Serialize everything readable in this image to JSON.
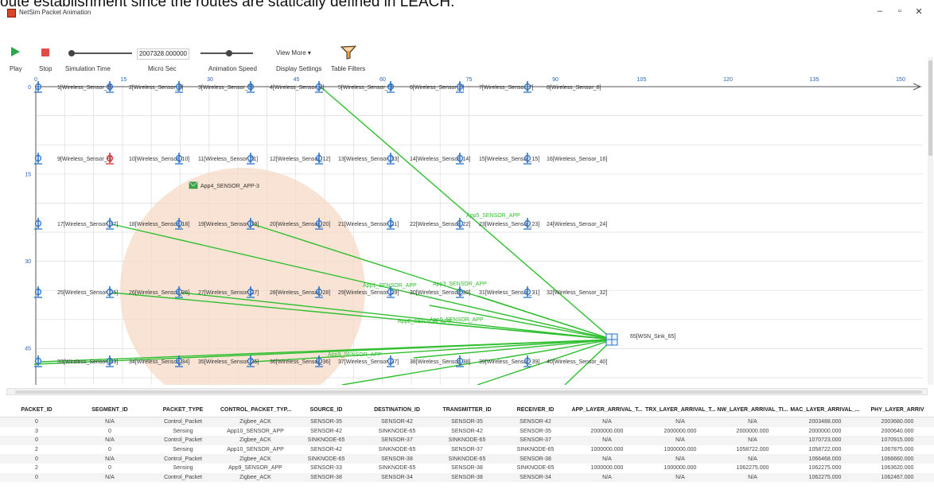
{
  "document": {
    "text": "oute establishment since the routes are statically defined in LEACH."
  },
  "window": {
    "title": "NetSim Packet Animation",
    "minimize": "–",
    "maximize": "▫",
    "close": "✕"
  },
  "toolbar": {
    "play_label": "Play",
    "stop_label": "Stop",
    "sim_time_label": "Simulation Time",
    "sim_time_value": "2007328.000000",
    "micro_sec_label": "Micro Sec",
    "anim_speed_label": "Animation Speed",
    "view_more_label": "View More ▾",
    "display_settings_label": "Display Settings",
    "table_filters_label": "Table Filters",
    "sim_time_progress": 0.02,
    "anim_speed_level": 0.55
  },
  "canvas": {
    "x_ticks": [
      "0",
      "15",
      "30",
      "45",
      "60",
      "75",
      "90",
      "105",
      "120",
      "135",
      "150"
    ],
    "y_ticks": [
      "0",
      "15",
      "30",
      "45"
    ],
    "circle_label": "App4_SENSOR_APP-3",
    "nodes": [
      {
        "id": 1,
        "label": "1[Wireless_Sensor_1]"
      },
      {
        "id": 2,
        "label": "2[Wireless_Sensor_2]"
      },
      {
        "id": 3,
        "label": "3[Wireless_Sensor_3]"
      },
      {
        "id": 4,
        "label": "4[Wireless_Sensor_4]"
      },
      {
        "id": 5,
        "label": "5[Wireless_Sensor_5]"
      },
      {
        "id": 6,
        "label": "6[Wireless_Sensor_6]"
      },
      {
        "id": 7,
        "label": "7[Wireless_Sensor_7]"
      },
      {
        "id": 8,
        "label": "8[Wireless_Sensor_8]"
      },
      {
        "id": 9,
        "label": "9[Wireless_Sensor_9]"
      },
      {
        "id": 10,
        "label": "10[Wireless_Sensor_10]"
      },
      {
        "id": 11,
        "label": "11[Wireless_Sensor_11]"
      },
      {
        "id": 12,
        "label": "12[Wireless_Sensor_12]"
      },
      {
        "id": 13,
        "label": "13[Wireless_Sensor_13]"
      },
      {
        "id": 14,
        "label": "14[Wireless_Sensor_14]"
      },
      {
        "id": 15,
        "label": "15[Wireless_Sensor_15]"
      },
      {
        "id": 16,
        "label": "16[Wireless_Sensor_16]"
      },
      {
        "id": 17,
        "label": "17[Wireless_Sensor_17]"
      },
      {
        "id": 18,
        "label": "18[Wireless_Sensor_18]"
      },
      {
        "id": 19,
        "label": "19[Wireless_Sensor_19]"
      },
      {
        "id": 20,
        "label": "20[Wireless_Sensor_20]"
      },
      {
        "id": 21,
        "label": "21[Wireless_Sensor_21]"
      },
      {
        "id": 22,
        "label": "22[Wireless_Sensor_22]"
      },
      {
        "id": 23,
        "label": "23[Wireless_Sensor_23]"
      },
      {
        "id": 24,
        "label": "24[Wireless_Sensor_24]"
      },
      {
        "id": 25,
        "label": "25[Wireless_Sensor_25]"
      },
      {
        "id": 26,
        "label": "26[Wireless_Sensor_26]"
      },
      {
        "id": 27,
        "label": "27[Wireless_Sensor_27]"
      },
      {
        "id": 28,
        "label": "28[Wireless_Sensor_28]"
      },
      {
        "id": 29,
        "label": "29[Wireless_Sensor_29]"
      },
      {
        "id": 30,
        "label": "30[Wireless_Sensor_30]"
      },
      {
        "id": 31,
        "label": "31[Wireless_Sensor_31]"
      },
      {
        "id": 32,
        "label": "32[Wireless_Sensor_32]"
      },
      {
        "id": 33,
        "label": "33[Wireless_Sensor_33]"
      },
      {
        "id": 34,
        "label": "34[Wireless_Sensor_34]"
      },
      {
        "id": 35,
        "label": "35[Wireless_Sensor_35]"
      },
      {
        "id": 36,
        "label": "36[Wireless_Sensor_36]"
      },
      {
        "id": 37,
        "label": "37[Wireless_Sensor_37]"
      },
      {
        "id": 38,
        "label": "38[Wireless_Sensor_38]"
      },
      {
        "id": 39,
        "label": "39[Wireless_Sensor_39]"
      },
      {
        "id": 40,
        "label": "40[Wireless_Sensor_40]"
      }
    ],
    "sink_label": "65[WSN_Sink_65]",
    "flow_labels": [
      "App5_SENSOR_APP",
      "App1_SENSOR_APP",
      "App3_SENSOR_APP",
      "App2_SENSOR_APP",
      "App6_SENSOR_APP",
      "App9_SENSOR_APP"
    ]
  },
  "table": {
    "columns": [
      "PACKET_ID",
      "SEGMENT_ID",
      "PACKET_TYPE",
      "CONTROL_PACKET_TYP...",
      "SOURCE_ID",
      "DESTINATION_ID",
      "TRANSMITTER_ID",
      "RECEIVER_ID",
      "APP_LAYER_ARRIVAL_T...",
      "TRX_LAYER_ARRIVAL_T...",
      "NW_LAYER_ARRIVAL_TI...",
      "MAC_LAYER_ARRIVAL_...",
      "PHY_LAYER_ARRIV"
    ],
    "rows": [
      [
        "0",
        "N/A",
        "Control_Packet",
        "Zigbee_ACK",
        "SENSOR-35",
        "SENSOR-42",
        "SENSOR-35",
        "SENSOR-42",
        "N/A",
        "N/A",
        "N/A",
        "2003488.000",
        "2003680.000"
      ],
      [
        "3",
        "0",
        "Sensing",
        "App10_SENSOR_APP",
        "SENSOR-42",
        "SINKNODE-65",
        "SENSOR-42",
        "SENSOR-35",
        "2000000.000",
        "2000000.000",
        "2000000.000",
        "2000000.000",
        "2000640.000"
      ],
      [
        "0",
        "N/A",
        "Control_Packet",
        "Zigbee_ACK",
        "SINKNODE-65",
        "SENSOR-37",
        "SINKNODE-65",
        "SENSOR-37",
        "N/A",
        "N/A",
        "N/A",
        "1070723.000",
        "1070915.000"
      ],
      [
        "2",
        "0",
        "Sensing",
        "App10_SENSOR_APP",
        "SENSOR-42",
        "SINKNODE-65",
        "SENSOR-37",
        "SINKNODE-65",
        "1000000.000",
        "1000000.000",
        "1058722.000",
        "1058722.000",
        "1067875.000"
      ],
      [
        "0",
        "N/A",
        "Control_Packet",
        "Zigbee_ACK",
        "SINKNODE-65",
        "SENSOR-38",
        "SINKNODE-65",
        "SENSOR-38",
        "N/A",
        "N/A",
        "N/A",
        "1066468.000",
        "1066660.000"
      ],
      [
        "2",
        "0",
        "Sensing",
        "App9_SENSOR_APP",
        "SENSOR-33",
        "SINKNODE-65",
        "SENSOR-38",
        "SINKNODE-65",
        "1000000.000",
        "1000000.000",
        "1062275.000",
        "1062275.000",
        "1063620.000"
      ],
      [
        "0",
        "N/A",
        "Control_Packet",
        "Zigbee_ACK",
        "SENSOR-38",
        "SENSOR-34",
        "SENSOR-38",
        "SENSOR-34",
        "N/A",
        "N/A",
        "N/A",
        "1062275.000",
        "1062467.000"
      ]
    ]
  },
  "colors": {
    "flow": "#2fbf2f",
    "grid": "#dcdcdc",
    "axis": "#555",
    "circle": "#f5d9c6",
    "sensor": "#2a73c9",
    "active_sensor": "#e03030"
  }
}
